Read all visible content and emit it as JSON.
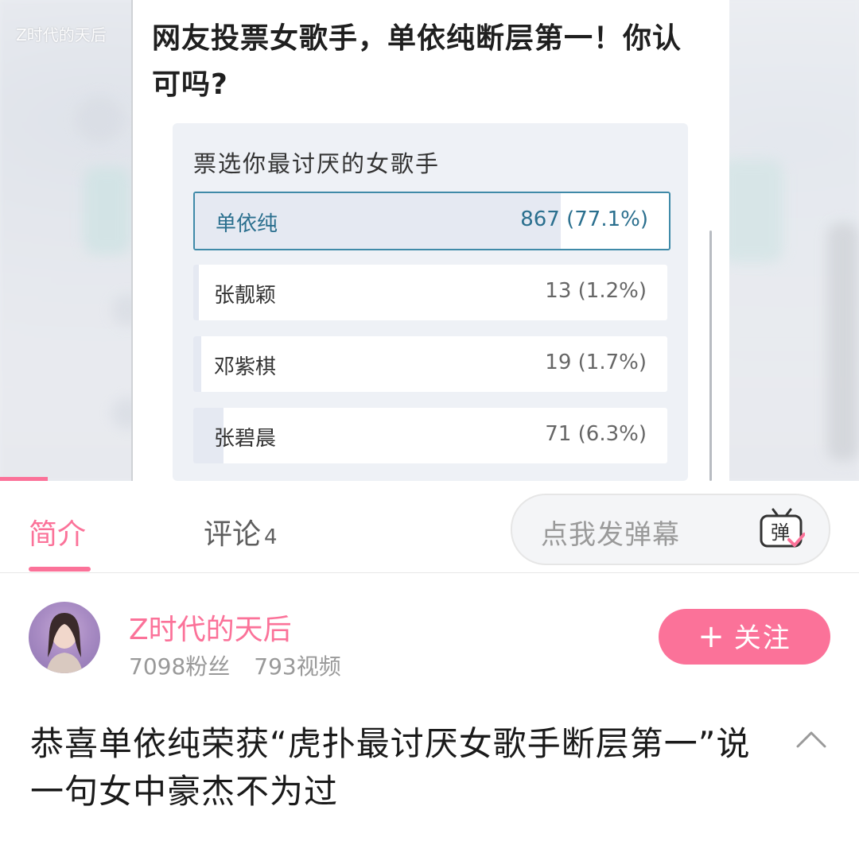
{
  "video": {
    "watermark": "Z时代的天后",
    "post_title": "网友投票女歌手，单依纯断层第一！你认可吗?",
    "poll": {
      "title": "票选你最讨厌的女歌手",
      "options": [
        {
          "name": "单依纯",
          "count": "867 (77.1%)",
          "share": 0.771,
          "selected": true
        },
        {
          "name": "张靓颖",
          "count": "13 (1.2%)",
          "share": 0.012,
          "selected": false
        },
        {
          "name": "邓紫棋",
          "count": "19 (1.7%)",
          "share": 0.017,
          "selected": false
        },
        {
          "name": "张碧晨",
          "count": "71 (6.3%)",
          "share": 0.063,
          "selected": false
        }
      ]
    }
  },
  "tabs": {
    "intro": "简介",
    "comments": "评论",
    "comments_count": "4",
    "danmaku_placeholder": "点我发弹幕",
    "danmaku_icon_label": "弹"
  },
  "uploader": {
    "name": "Z时代的天后",
    "followers": "7098粉丝",
    "videos": "793视频",
    "follow_label": "关注"
  },
  "video_info": {
    "title": "恭喜单依纯荣获“虎扑最讨厌女歌手断层第一”说一句女中豪杰不为过"
  },
  "colors": {
    "accent": "#fb7299",
    "selected_option": "#3f8aa8"
  },
  "icons": [
    "danmaku-tv-icon",
    "chevron-up-icon",
    "plus-icon"
  ]
}
